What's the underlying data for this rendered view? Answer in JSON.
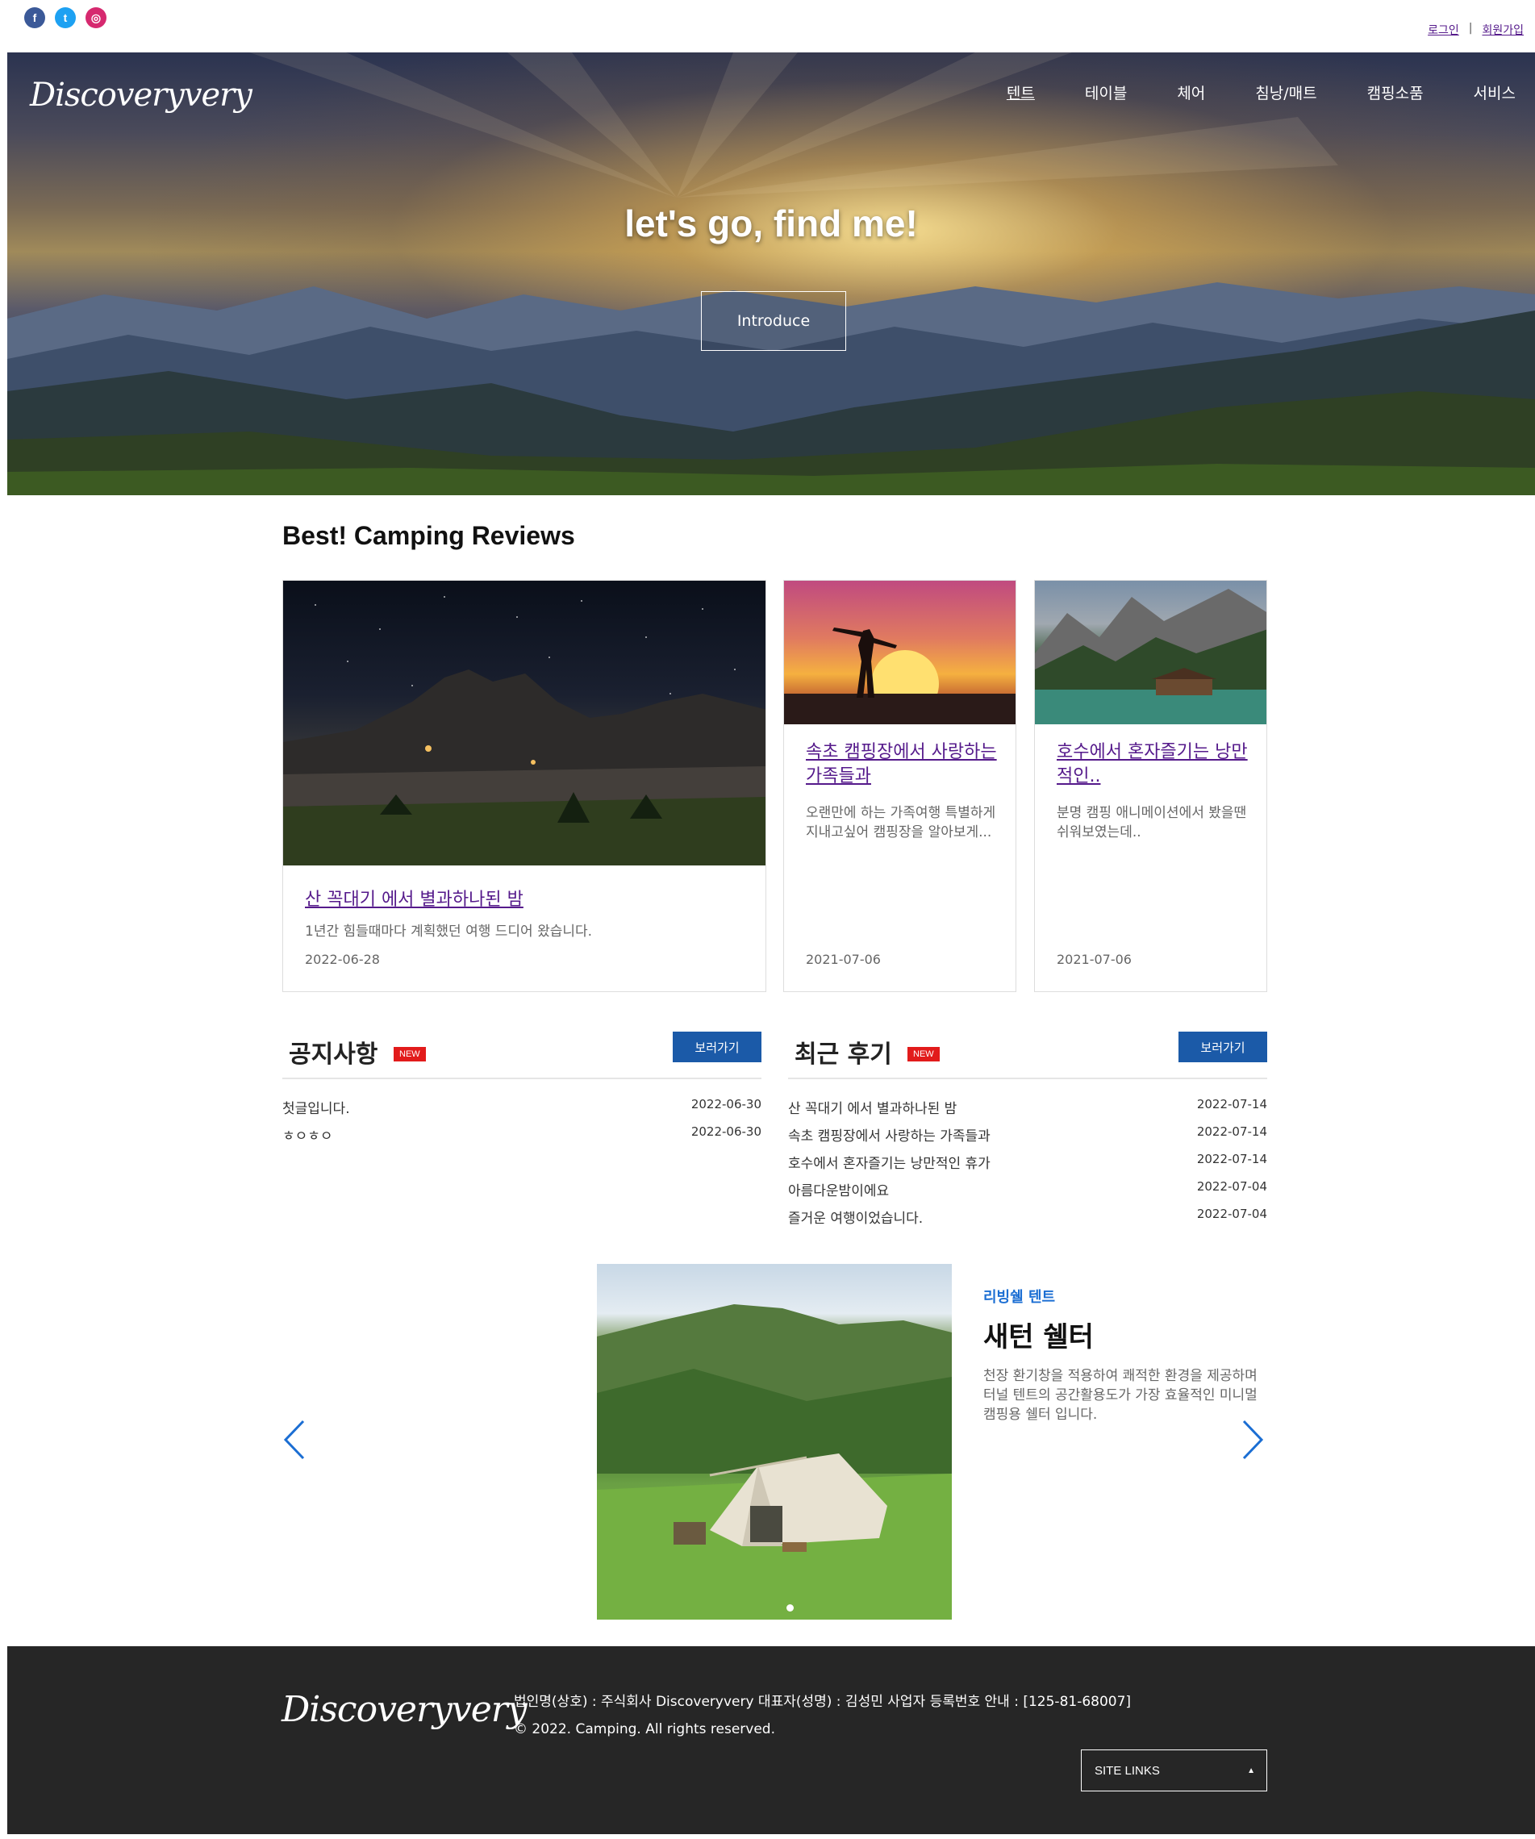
{
  "topbar": {
    "social": [
      {
        "name": "facebook",
        "glyph": "f",
        "color": "#3b5998"
      },
      {
        "name": "twitter",
        "glyph": "t",
        "color": "#1da1f2"
      },
      {
        "name": "instagram",
        "glyph": "◎",
        "color": "#d6296f"
      }
    ],
    "login": "로그인",
    "separator": "|",
    "signup": "회원가입"
  },
  "hero": {
    "logo": "Discoveryvery",
    "nav": [
      "텐트",
      "테이블",
      "체어",
      "침낭/매트",
      "캠핑소품",
      "서비스"
    ],
    "headline": "let's go, find me!",
    "button": "Introduce"
  },
  "reviews": {
    "title": "Best! Camping Reviews",
    "cards": [
      {
        "title": "산 꼭대기 에서 별과하나된 밤",
        "desc": "1년간 힘들때마다 계획했던 여행 드디어 왔습니다.",
        "date": "2022-06-28"
      },
      {
        "title": "속초 캠핑장에서 사랑하는 가족들과",
        "desc": "오랜만에 하는 가족여행 특별하게 지내고싶어 캠핑장을 알아보게...",
        "date": "2021-07-06"
      },
      {
        "title": "호수에서 혼자즐기는 낭만적인..",
        "desc": "분명 캠핑 애니메이션에서 봤을땐 쉬워보였는데..",
        "date": "2021-07-06"
      }
    ]
  },
  "notice": {
    "title": "공지사항",
    "badge": "NEW",
    "more": "보러가기",
    "items": [
      {
        "text": "첫글입니다.",
        "date": "2022-06-30"
      },
      {
        "text": "ㅎㅇㅎㅇ",
        "date": "2022-06-30"
      }
    ]
  },
  "recent": {
    "title": "최근 후기",
    "badge": "NEW",
    "more": "보러가기",
    "items": [
      {
        "text": "산 꼭대기 에서 별과하나된 밤",
        "date": "2022-07-14"
      },
      {
        "text": "속초 캠핑장에서 사랑하는 가족들과",
        "date": "2022-07-14"
      },
      {
        "text": "호수에서 혼자즐기는 낭만적인 휴가",
        "date": "2022-07-14"
      },
      {
        "text": "아름다운밤이에요",
        "date": "2022-07-04"
      },
      {
        "text": "즐거운 여행이었습니다.",
        "date": "2022-07-04"
      }
    ]
  },
  "slider": {
    "subtitle": "리빙쉘 텐트",
    "title": "새턴 쉘터",
    "desc": "천장 환기창을 적용하여 쾌적한 환경을 제공하며 터널 텐트의 공간활용도가 가장 효율적인 미니멀 캠핑용 쉘터 입니다.",
    "accent": "#1b6ed3"
  },
  "footer": {
    "logo": "Discoveryvery",
    "company": "법인명(상호) : 주식회사 Discoveryvery 대표자(성명) : 김성민 사업자 등록번호 안내 : [125-81-68007]",
    "copyright": "© 2022. Camping. All rights reserved.",
    "site_links": "SITE LINKS"
  }
}
